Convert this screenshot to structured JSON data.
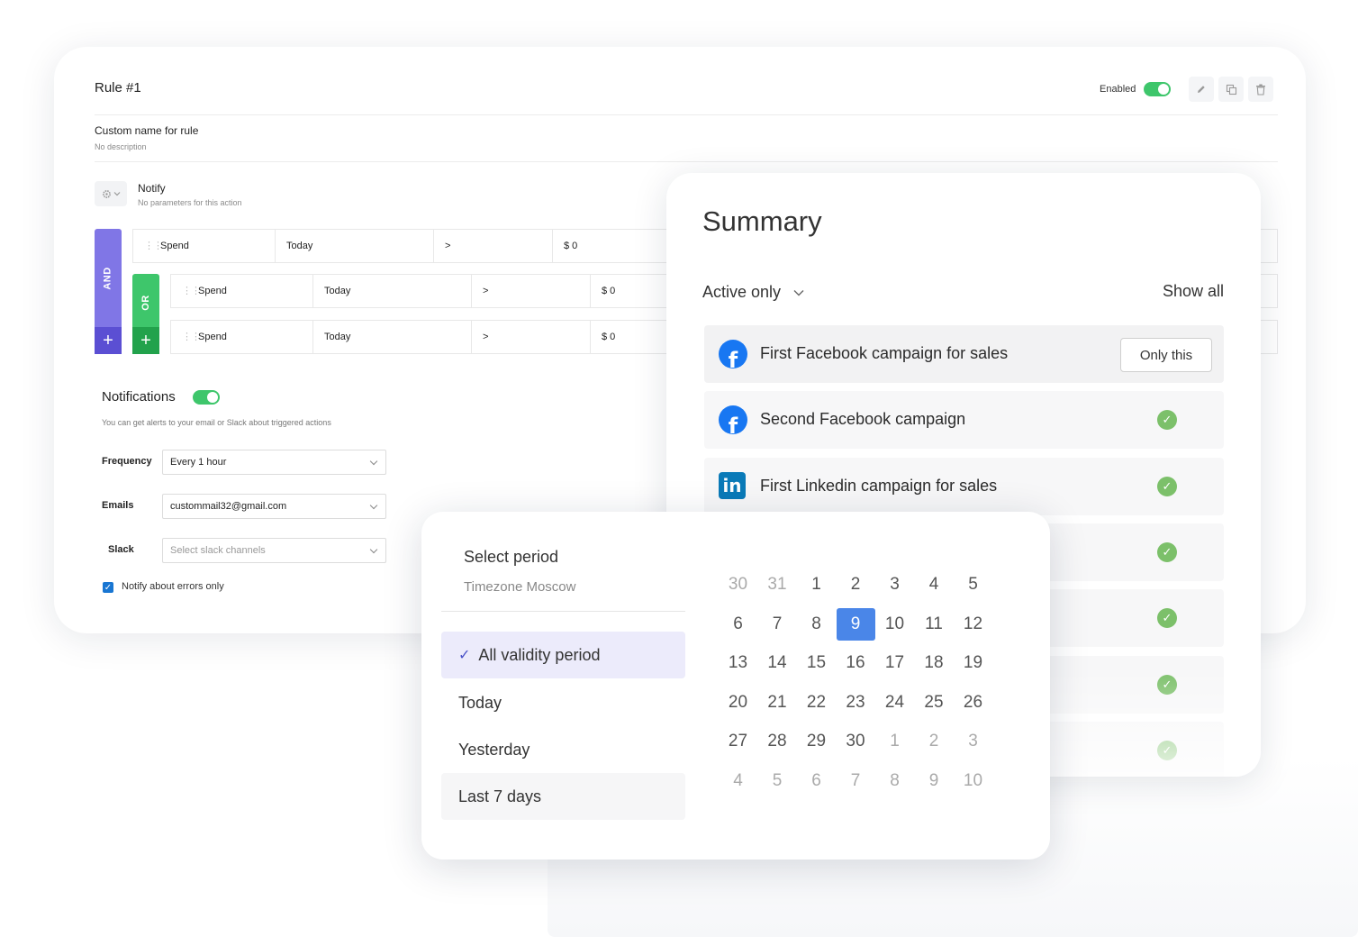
{
  "rule": {
    "title": "Rule #1",
    "enabled_label": "Enabled",
    "enabled": true,
    "name": "Custom name for rule",
    "description": "No description",
    "action": {
      "title": "Notify",
      "description": "No parameters for this action"
    },
    "and_label": "AND",
    "or_label": "OR",
    "conditions": [
      {
        "metric": "Spend",
        "period": "Today",
        "operator": ">",
        "value": "$ 0"
      },
      {
        "metric": "Spend",
        "period": "Today",
        "operator": ">",
        "value": "$ 0"
      },
      {
        "metric": "Spend",
        "period": "Today",
        "operator": ">",
        "value": "$ 0"
      }
    ],
    "notifications": {
      "title": "Notifications",
      "enabled": true,
      "description": "You can get alerts to your email or Slack about triggered actions",
      "frequency_label": "Frequency",
      "frequency_value": "Every 1 hour",
      "emails_label": "Emails",
      "emails_value": "custommail32@gmail.com",
      "slack_label": "Slack",
      "slack_placeholder": "Select slack channels",
      "errors_only_label": "Notify about errors only",
      "errors_only_checked": true
    }
  },
  "summary": {
    "title": "Summary",
    "filter_label": "Active only",
    "show_all": "Show all",
    "only_this": "Only this",
    "campaigns": [
      {
        "name": "First Facebook campaign for sales",
        "network": "facebook",
        "active": true
      },
      {
        "name": "Second Facebook campaign",
        "network": "facebook",
        "active": true
      },
      {
        "name": "First Linkedin campaign for sales",
        "network": "linkedin",
        "active": true
      }
    ],
    "extra_active_count": 4
  },
  "period": {
    "title": "Select period",
    "timezone": "Timezone Moscow",
    "options": [
      {
        "label": "All validity period",
        "selected": true
      },
      {
        "label": "Today",
        "selected": false
      },
      {
        "label": "Yesterday",
        "selected": false
      },
      {
        "label": "Last 7 days",
        "selected": false
      }
    ],
    "calendar": {
      "weeks": [
        [
          "30",
          "31",
          "1",
          "2",
          "3",
          "4",
          "5"
        ],
        [
          "6",
          "7",
          "8",
          "9",
          "10",
          "11",
          "12"
        ],
        [
          "13",
          "14",
          "15",
          "16",
          "17",
          "18",
          "19"
        ],
        [
          "20",
          "21",
          "22",
          "23",
          "24",
          "25",
          "26"
        ],
        [
          "27",
          "28",
          "29",
          "30",
          "1",
          "2",
          "3"
        ],
        [
          "4",
          "5",
          "6",
          "7",
          "8",
          "9",
          "10"
        ]
      ],
      "selected_day": "9"
    }
  },
  "colors": {
    "and": "#8076e6",
    "or": "#3ec66b",
    "toggle_on": "#3ec66b",
    "selected_day": "#4a86e8",
    "check": "#7cc06a",
    "facebook": "#1877f2",
    "linkedin": "#0a7ab8"
  },
  "icons": [
    "pencil-icon",
    "copy-icon",
    "trash-icon",
    "gear-icon",
    "chevron-down-icon",
    "drag-handle-icon",
    "facebook-icon",
    "linkedin-icon",
    "checkmark-icon",
    "plus-icon"
  ]
}
